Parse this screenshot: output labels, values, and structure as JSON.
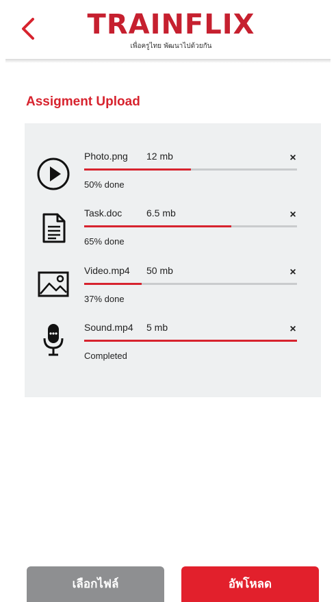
{
  "header": {
    "back_icon": "chevron-left-icon",
    "logo_text": "TRAINFLIX",
    "logo_tagline": "เพื่อครูไทย พัฒนาไปด้วยกัน"
  },
  "colors": {
    "accent": "#d7232e",
    "button_secondary": "#8e8f91",
    "panel_bg": "#eef0f1"
  },
  "section_title": "Assigment Upload",
  "files": [
    {
      "name": "Photo.png",
      "size": "12 mb",
      "status": "50% done",
      "progress": 0.5,
      "icon": "play-circle-icon"
    },
    {
      "name": "Task.doc",
      "size": "6.5 mb",
      "status": "65% done",
      "progress": 0.69,
      "icon": "document-icon"
    },
    {
      "name": "Video.mp4",
      "size": "50 mb",
      "status": "37% done",
      "progress": 0.27,
      "icon": "image-icon"
    },
    {
      "name": "Sound.mp4",
      "size": "5 mb",
      "status": "Completed",
      "progress": 1.0,
      "icon": "microphone-icon"
    }
  ],
  "remove_label": "×",
  "buttons": {
    "choose_file": "เลือกไฟล์",
    "upload": "อัพโหลด"
  }
}
